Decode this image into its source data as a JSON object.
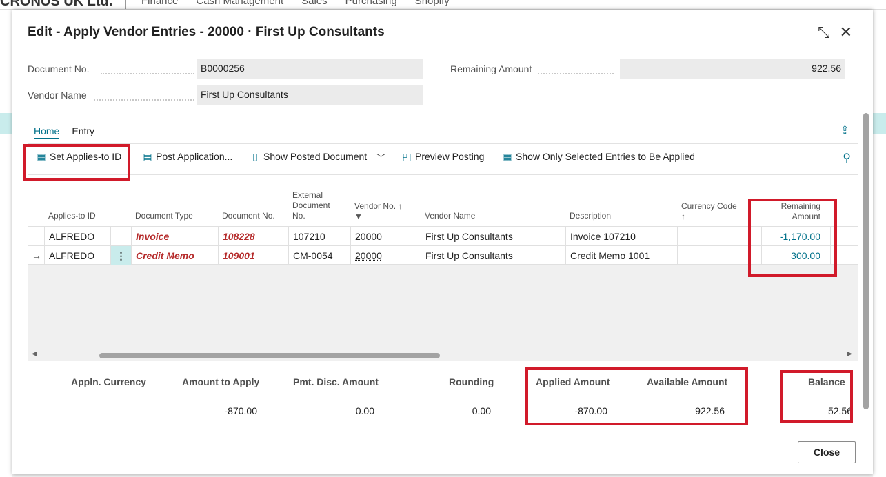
{
  "background": {
    "company": "CRONUS UK Ltd.",
    "nav": [
      "Finance",
      "Cash Management",
      "Sales",
      "Purchasing",
      "Shopify"
    ]
  },
  "dialog": {
    "title": "Edit - Apply Vendor Entries - 20000 · First Up Consultants",
    "document_no_label": "Document No.",
    "document_no": "B0000256",
    "vendor_name_label": "Vendor Name",
    "vendor_name": "First Up Consultants",
    "remaining_amount_label": "Remaining Amount",
    "remaining_amount": "922.56"
  },
  "tabs": [
    "Home",
    "Entry"
  ],
  "toolbar": {
    "set_applies_to_id": "Set Applies-to ID",
    "post_application": "Post Application...",
    "show_posted_document": "Show Posted Document",
    "preview_posting": "Preview Posting",
    "show_only_selected": "Show Only Selected Entries to Be Applied"
  },
  "columns": {
    "applies_to_id": "Applies-to ID",
    "document_type": "Document Type",
    "document_no": "Document No.",
    "external_document_no": "External Document No.",
    "vendor_no": "Vendor No.",
    "vendor_name": "Vendor Name",
    "description": "Description",
    "currency_code": "Currency Code",
    "remaining_amount": "Remaining Amount"
  },
  "rows": [
    {
      "applies_to_id": "ALFREDO",
      "document_type": "Invoice",
      "document_no": "108228",
      "external_document_no": "107210",
      "vendor_no": "20000",
      "vendor_name": "First Up Consultants",
      "description": "Invoice 107210",
      "currency_code": "",
      "remaining_amount": "-1,170.00"
    },
    {
      "applies_to_id": "ALFREDO",
      "document_type": "Credit Memo",
      "document_no": "109001",
      "external_document_no": "CM-0054",
      "vendor_no": "20000",
      "vendor_name": "First Up Consultants",
      "description": "Credit Memo 1001",
      "currency_code": "",
      "remaining_amount": "300.00"
    }
  ],
  "totals": {
    "appln_currency_label": "Appln. Currency",
    "appln_currency": "",
    "amount_to_apply_label": "Amount to Apply",
    "amount_to_apply": "-870.00",
    "pmt_disc_amount_label": "Pmt. Disc. Amount",
    "pmt_disc_amount": "0.00",
    "rounding_label": "Rounding",
    "rounding": "0.00",
    "applied_amount_label": "Applied Amount",
    "applied_amount": "-870.00",
    "available_amount_label": "Available Amount",
    "available_amount": "922.56",
    "balance_label": "Balance",
    "balance": "52.56"
  },
  "close_label": "Close",
  "colors": {
    "accent": "#00718a",
    "link_red": "#b52a2a",
    "highlight_red": "#d11a2a"
  }
}
